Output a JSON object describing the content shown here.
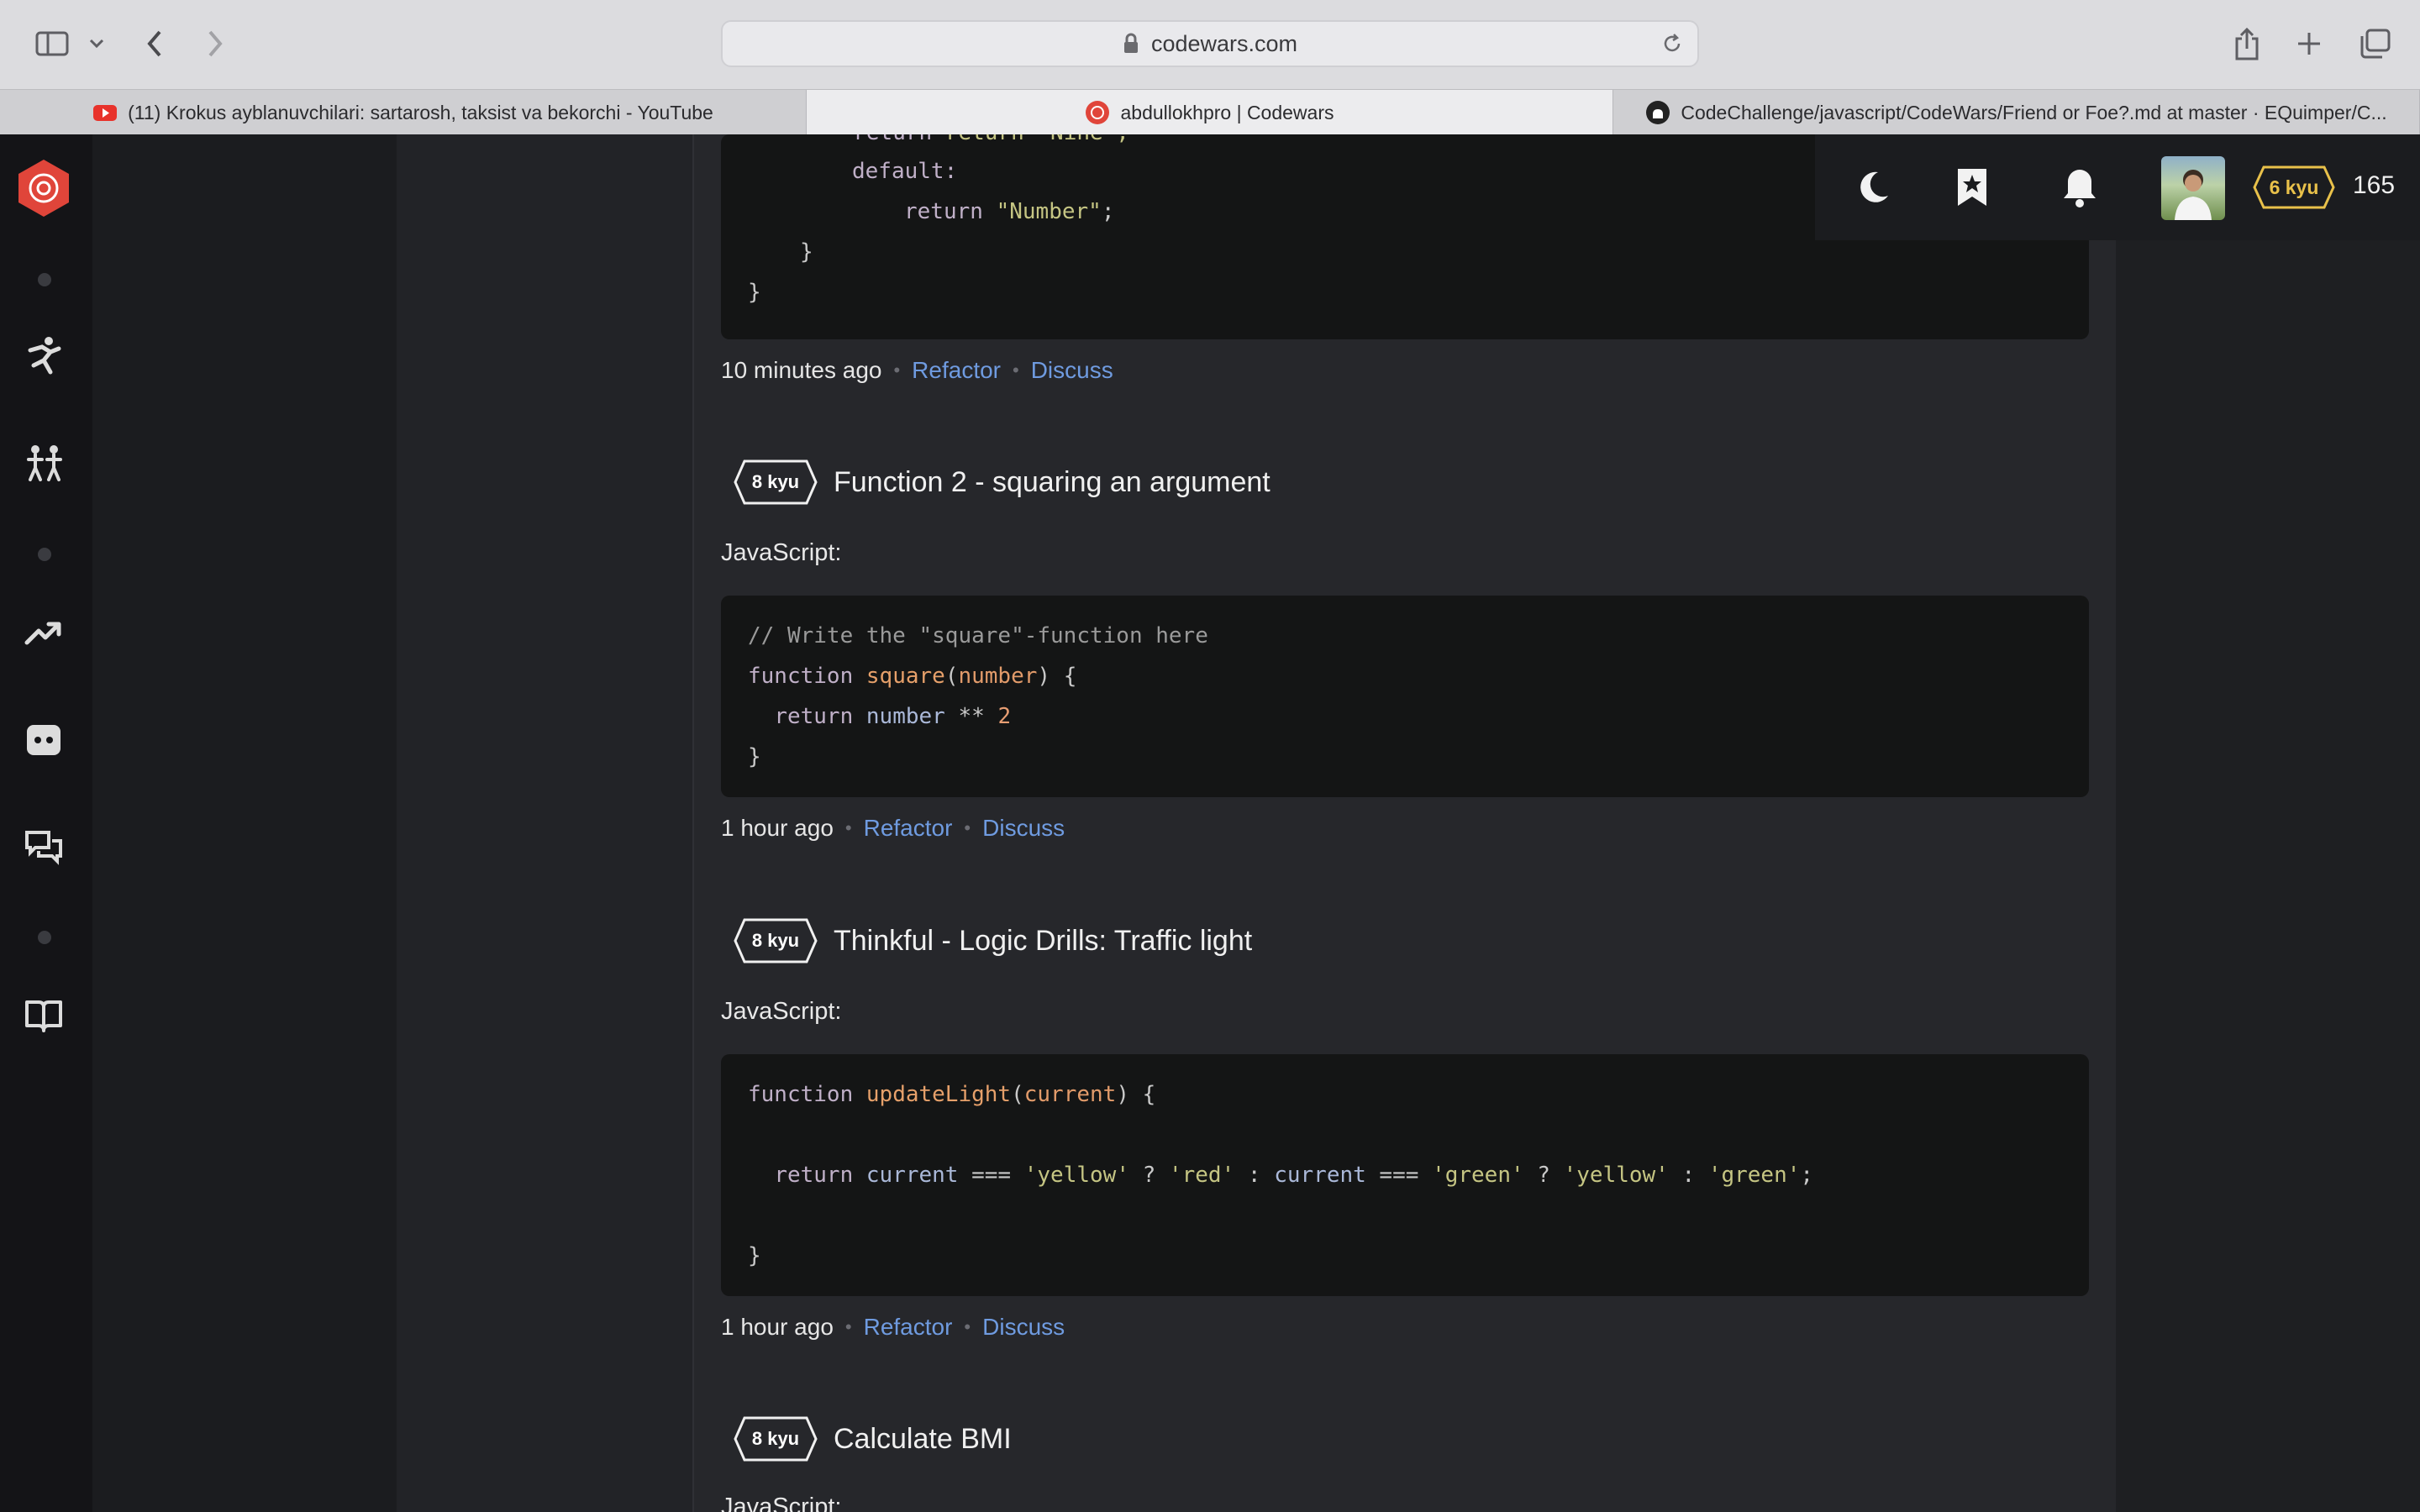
{
  "browser": {
    "url": "codewars.com",
    "tabs": [
      {
        "label": "(11) Krokus ayblanuvchilari: sartarosh, taksist va bekorchi - YouTube",
        "active": false
      },
      {
        "label": "abdullokhpro | Codewars",
        "active": true
      },
      {
        "label": "CodeChallenge/javascript/CodeWars/Friend or Foe?.md at master · EQuimper/C...",
        "active": false
      }
    ]
  },
  "header": {
    "rank": "6 kyu",
    "honor": "165"
  },
  "solutions": [
    {
      "code_tail": [
        "return \"Nine\";",
        "default:",
        "return \"Number\";",
        "}",
        "}"
      ],
      "time": "10 minutes ago",
      "refactor": "Refactor",
      "discuss": "Discuss"
    },
    {
      "kyu": "8 kyu",
      "title": "Function 2 - squaring an argument",
      "language": "JavaScript:",
      "code": [
        "// Write the \"square\"-function here",
        "function square(number) {",
        "return number ** 2",
        "}"
      ],
      "time": "1 hour ago",
      "refactor": "Refactor",
      "discuss": "Discuss"
    },
    {
      "kyu": "8 kyu",
      "title": "Thinkful - Logic Drills: Traffic light",
      "language": "JavaScript:",
      "code": [
        "function updateLight(current) {",
        "return current === 'yellow' ? 'red' : current === 'green' ? 'yellow' : 'green';",
        "}"
      ],
      "time": "1 hour ago",
      "refactor": "Refactor",
      "discuss": "Discuss"
    },
    {
      "kyu": "8 kyu",
      "title": "Calculate BMI",
      "language": "JavaScript:"
    }
  ],
  "colors": {
    "accent_red": "#e0453a",
    "link_blue": "#6f9be0",
    "rank_yellow": "#e9c14a"
  }
}
